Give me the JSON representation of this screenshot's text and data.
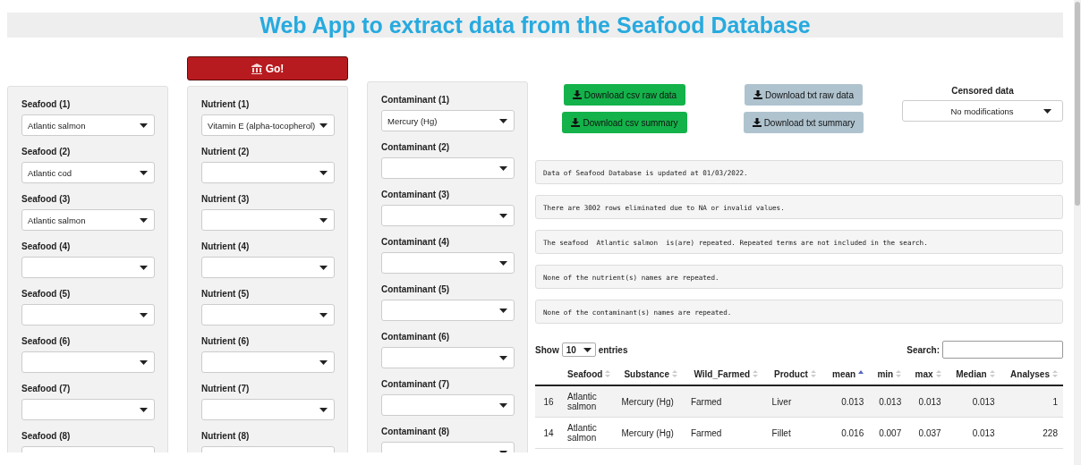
{
  "title": "Web App to extract data from the Seafood Database",
  "go_button": "Go!",
  "panels": [
    {
      "fields": [
        {
          "label": "Seafood (1)",
          "value": "Atlantic salmon"
        },
        {
          "label": "Seafood (2)",
          "value": "Atlantic cod"
        },
        {
          "label": "Seafood (3)",
          "value": "Atlantic salmon"
        },
        {
          "label": "Seafood (4)"
        },
        {
          "label": "Seafood (5)"
        },
        {
          "label": "Seafood (6)"
        },
        {
          "label": "Seafood (7)"
        },
        {
          "label": "Seafood (8)"
        }
      ]
    },
    {
      "fields": [
        {
          "label": "Nutrient (1)",
          "value": "Vitamin E (alpha-tocopherol)"
        },
        {
          "label": "Nutrient (2)"
        },
        {
          "label": "Nutrient (3)"
        },
        {
          "label": "Nutrient (4)"
        },
        {
          "label": "Nutrient (5)"
        },
        {
          "label": "Nutrient (6)"
        },
        {
          "label": "Nutrient (7)"
        },
        {
          "label": "Nutrient (8)"
        }
      ]
    },
    {
      "fields": [
        {
          "label": "Contaminant (1)",
          "value": "Mercury (Hg)"
        },
        {
          "label": "Contaminant (2)"
        },
        {
          "label": "Contaminant (3)"
        },
        {
          "label": "Contaminant (4)"
        },
        {
          "label": "Contaminant (5)"
        },
        {
          "label": "Contaminant (6)"
        },
        {
          "label": "Contaminant (7)"
        },
        {
          "label": "Contaminant (8)"
        }
      ]
    }
  ],
  "download_groups": [
    {
      "kind": "csv",
      "buttons": [
        "Download csv raw data",
        "Download csv summary"
      ]
    },
    {
      "kind": "txt",
      "buttons": [
        "Download txt raw data",
        "Download txt summary"
      ]
    }
  ],
  "censored": {
    "label": "Censored data",
    "value": "No modifications"
  },
  "messages": [
    "Data of Seafood Database is updated at 01/03/2022.",
    "There are 3002 rows eliminated due to NA or invalid values.",
    "The seafood  Atlantic salmon  is(are) repeated. Repeated terms are not included in the search.",
    "None of the nutrient(s) names are repeated.",
    "None of the contaminant(s) names are repeated."
  ],
  "table": {
    "show_label": "Show",
    "entries_value": "10",
    "entries_label": "entries",
    "search_label": "Search:",
    "columns": [
      {
        "label": "Seafood",
        "sorted": false,
        "kind": "text"
      },
      {
        "label": "Substance",
        "sorted": false,
        "kind": "text"
      },
      {
        "label": "Wild_Farmed",
        "sorted": false,
        "kind": "text"
      },
      {
        "label": "Product",
        "sorted": false,
        "kind": "text"
      },
      {
        "label": "mean",
        "sorted": true,
        "kind": "number"
      },
      {
        "label": "min",
        "sorted": false,
        "kind": "number"
      },
      {
        "label": "max",
        "sorted": false,
        "kind": "number"
      },
      {
        "label": "Median",
        "sorted": false,
        "kind": "number"
      },
      {
        "label": "Analyses",
        "sorted": false,
        "kind": "number"
      }
    ],
    "rows": [
      {
        "index": "16",
        "cells": [
          "Atlantic salmon",
          "Mercury (Hg)",
          "Farmed",
          "Liver",
          "0.013",
          "0.013",
          "0.013",
          "0.013",
          "1"
        ]
      },
      {
        "index": "14",
        "cells": [
          "Atlantic salmon",
          "Mercury (Hg)",
          "Farmed",
          "Fillet",
          "0.016",
          "0.007",
          "0.037",
          "0.013",
          "228"
        ]
      }
    ]
  }
}
